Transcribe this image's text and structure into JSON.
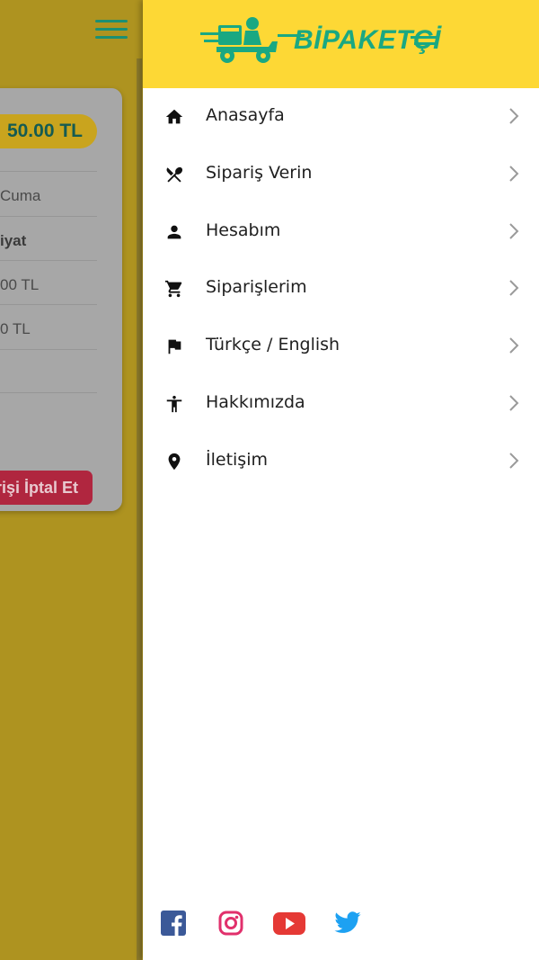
{
  "background": {
    "price": "50.00 TL",
    "rows": [
      "Cuma",
      "iyat",
      "00 TL",
      "0 TL"
    ],
    "cancel_label": "rişi İptal Et"
  },
  "header": {
    "logo_text": "BİPAKETÇİ"
  },
  "menu": {
    "items": [
      {
        "label": "Anasayfa",
        "icon": "home-icon"
      },
      {
        "label": "Sipariş Verin",
        "icon": "utensils-icon"
      },
      {
        "label": "Hesabım",
        "icon": "person-icon"
      },
      {
        "label": "Siparişlerim",
        "icon": "cart-icon"
      },
      {
        "label": "Türkçe / English",
        "icon": "flag-icon"
      },
      {
        "label": "Hakkımızda",
        "icon": "accessibility-icon"
      },
      {
        "label": "İletişim",
        "icon": "location-pin-icon"
      }
    ]
  },
  "socials": [
    "facebook-icon",
    "instagram-icon",
    "youtube-icon",
    "twitter-icon"
  ],
  "colors": {
    "header_bg": "#fdd835",
    "brand_green": "#1aa882",
    "facebook": "#3b5998",
    "instagram": "#e1306c",
    "youtube": "#e53935",
    "twitter": "#1da1f2"
  }
}
